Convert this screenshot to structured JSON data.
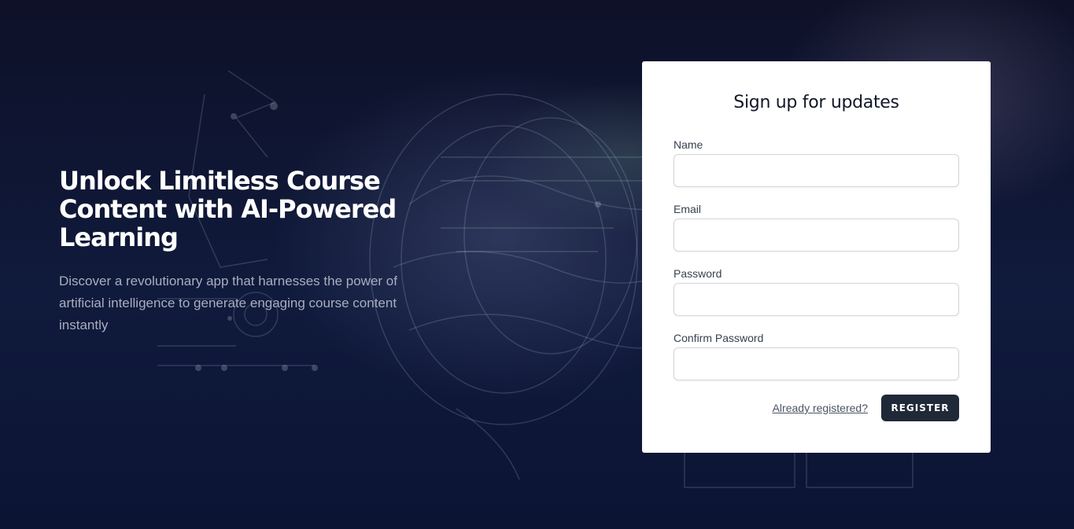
{
  "hero": {
    "title": "Unlock Limitless Course Content with AI-Powered Learning",
    "subtitle": "Discover a revolutionary app that harnesses the power of artificial intelligence to generate engaging course content instantly"
  },
  "form": {
    "title": "Sign up for updates",
    "fields": [
      {
        "label": "Name",
        "value": "",
        "type": "text"
      },
      {
        "label": "Email",
        "value": "",
        "type": "email"
      },
      {
        "label": "Password",
        "value": "",
        "type": "password"
      },
      {
        "label": "Confirm Password",
        "value": "",
        "type": "password"
      }
    ],
    "login_link": "Already registered?",
    "register_label": "REGISTER"
  },
  "colors": {
    "background": "#0d1330",
    "card": "#ffffff",
    "button": "#1f2937",
    "heading_text": "#ffffff",
    "subtitle_text": "#a9aebf"
  },
  "icons": {
    "background_art": "ai-brain-circuit-illustration"
  }
}
